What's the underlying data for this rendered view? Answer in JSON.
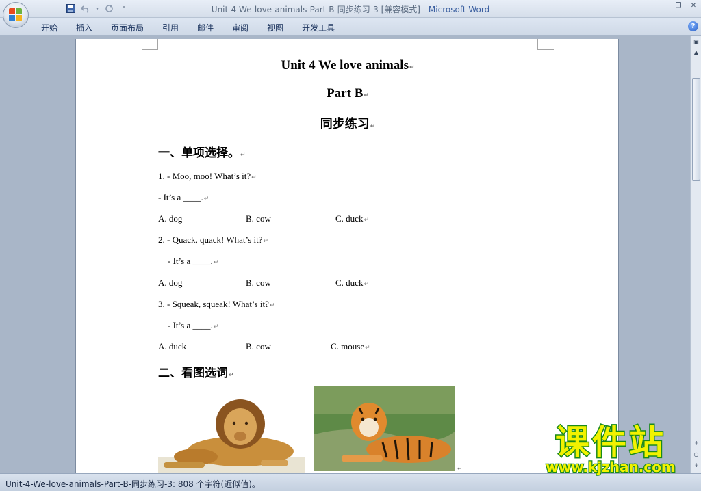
{
  "window": {
    "title": "Unit-4-We-love-animals-Part-B-同步练习-3 [兼容模式] - ",
    "app_name": "Microsoft Word"
  },
  "quick_access": [
    "save-icon",
    "undo-icon",
    "redo-icon",
    "customize-icon"
  ],
  "ribbon": {
    "tabs": [
      "开始",
      "插入",
      "页面布局",
      "引用",
      "邮件",
      "审阅",
      "视图",
      "开发工具"
    ]
  },
  "document": {
    "title": "Unit  4 We love animals",
    "subtitle": "Part B",
    "subtitle2": "同步练习",
    "section1": "一、单项选择。",
    "q1": {
      "question": "1. - Moo, moo! What’s it?",
      "answer": "- It’s a ____.",
      "options": [
        "A. dog",
        "B. cow",
        "C. duck"
      ]
    },
    "q2": {
      "question": "2. - Quack, quack! What’s it?",
      "answer": "- It’s a ____.",
      "options": [
        "A. dog",
        "B. cow",
        "C. duck"
      ]
    },
    "q3": {
      "question": "3. - Squeak, squeak! What’s it?",
      "answer": "- It’s a ____.",
      "options": [
        "A. duck",
        "B. cow",
        "C. mouse"
      ]
    },
    "section2": "二、看图选词",
    "images": [
      "lion",
      "tiger"
    ]
  },
  "status": {
    "text": "Unit-4-We-love-animals-Part-B-同步练习-3: 808 个字符(近似值)。"
  },
  "watermark": {
    "title": "课件站",
    "url": "www.kjzhan.com"
  },
  "colors": {
    "watermark_fill": "#f2f200",
    "watermark_stroke": "#1a8a1a",
    "app_name": "#3b5fa0"
  }
}
